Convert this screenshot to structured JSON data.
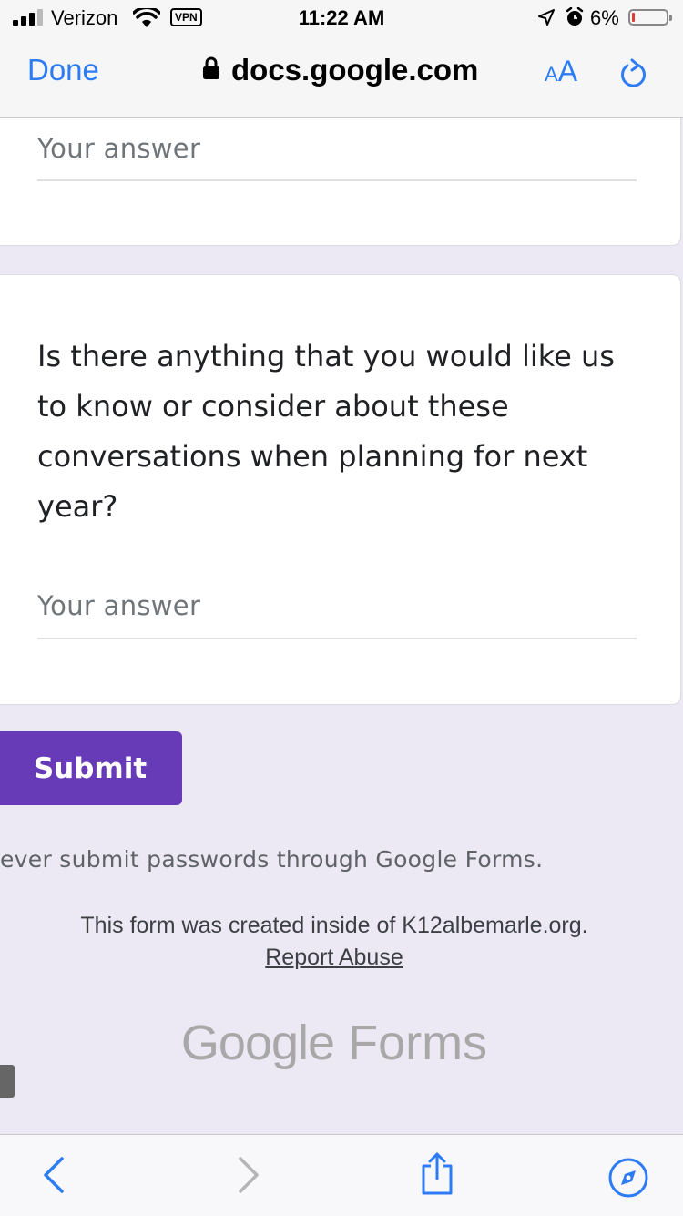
{
  "status_bar": {
    "carrier": "Verizon",
    "vpn": "VPN",
    "time": "11:22 AM",
    "battery_percent": "6%",
    "battery_level": 0.06,
    "icons": [
      "signal-icon",
      "wifi-icon",
      "location-icon",
      "alarm-icon",
      "battery-icon"
    ]
  },
  "browser": {
    "done_label": "Done",
    "url": "docs.google.com",
    "text_size_small": "A",
    "text_size_big": "A",
    "accent": "#2d7cf6"
  },
  "form": {
    "previous_answer_placeholder": "Your answer",
    "question": "Is there anything that you would like us to know or consider about these conversations when planning for next year?",
    "answer_placeholder": "Your answer",
    "submit_label": "Submit",
    "submit_color": "#673ab7",
    "password_warning": "ever submit passwords through Google Forms.",
    "created_notice": "This form was created inside of K12albemarle.org.",
    "report_abuse": "Report Abuse",
    "logo_google": "Google",
    "logo_forms": "Forms"
  },
  "toolbar": {
    "icons": [
      "back-icon",
      "forward-icon",
      "share-icon",
      "compass-icon"
    ]
  }
}
